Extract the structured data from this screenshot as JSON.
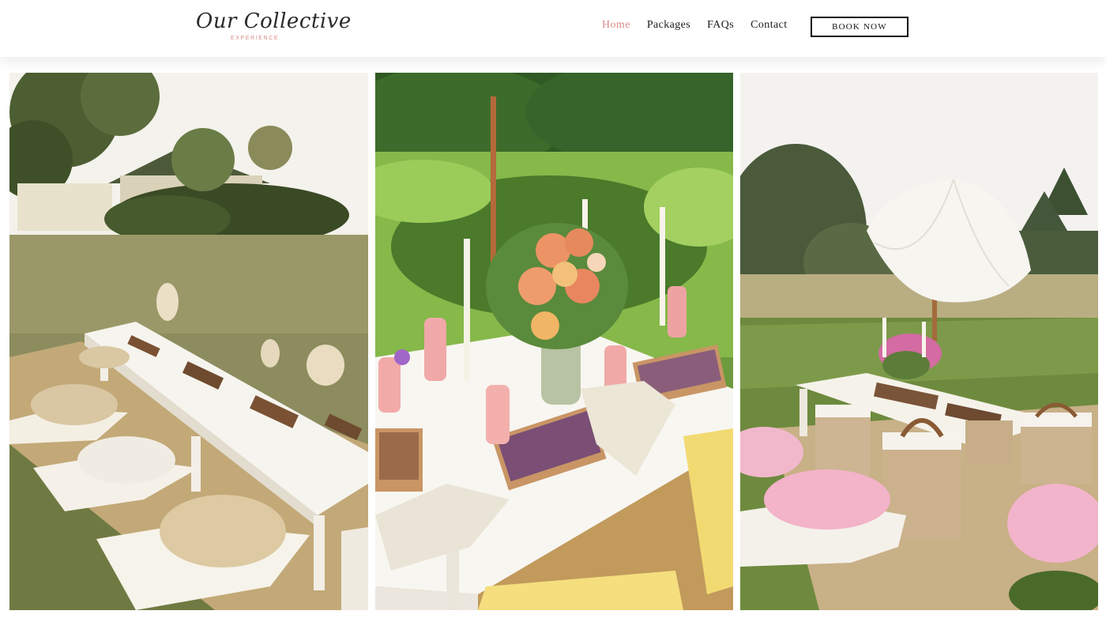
{
  "logo": {
    "script": "Our Collective",
    "sub": "EXPERIENCE"
  },
  "nav": {
    "items": [
      {
        "label": "Home",
        "active": true
      },
      {
        "label": "Packages",
        "active": false
      },
      {
        "label": "FAQs",
        "active": false
      },
      {
        "label": "Contact",
        "active": false
      }
    ],
    "cta": "BOOK NOW"
  },
  "colors": {
    "accent": "#d98a86",
    "text": "#1b1b1b"
  },
  "gallery": {
    "images": [
      {
        "name": "gallery-image-long-table-picnic"
      },
      {
        "name": "gallery-image-centerpiece-closeup"
      },
      {
        "name": "gallery-image-umbrella-picnic"
      }
    ]
  }
}
